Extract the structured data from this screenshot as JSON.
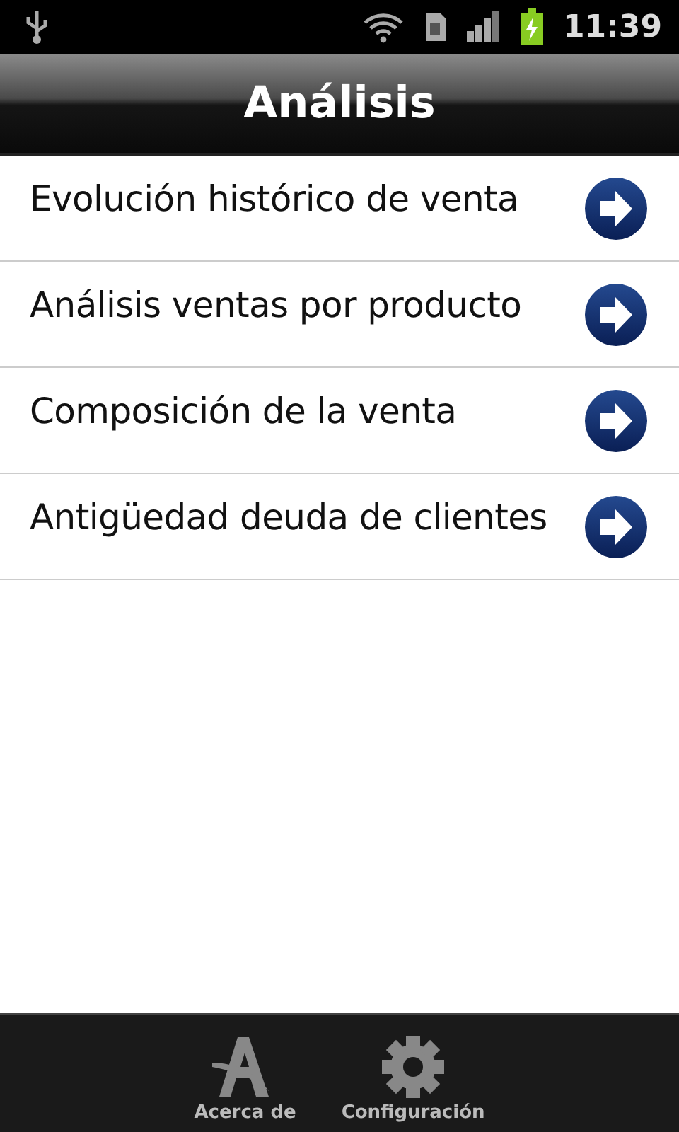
{
  "status_bar": {
    "time": "11:39"
  },
  "title_bar": {
    "title": "Análisis"
  },
  "menu_items": [
    {
      "label": "Evolución histórico de venta"
    },
    {
      "label": "Análisis ventas por producto"
    },
    {
      "label": "Composición de la venta"
    },
    {
      "label": "Antigüedad deuda de clientes"
    }
  ],
  "bottom_bar": [
    {
      "kind": "about",
      "label": "Acerca de"
    },
    {
      "kind": "settings",
      "label": "Configuración"
    }
  ]
}
